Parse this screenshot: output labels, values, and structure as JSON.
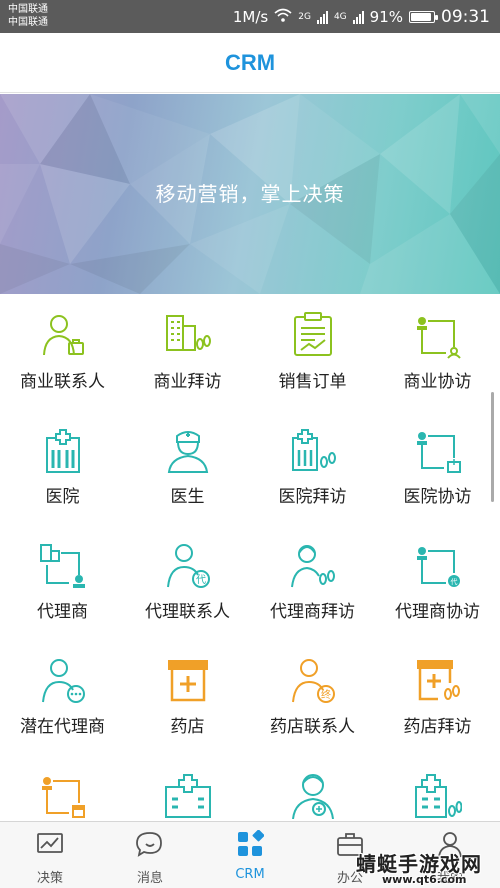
{
  "status_bar": {
    "carrier_1": "中国联通",
    "carrier_2": "中国联通",
    "speed": "1M/s",
    "net_label_1": "2G",
    "net_label_2": "4G",
    "battery_percent": "91%",
    "battery_level": 0.91,
    "time": "09:31",
    "icons": [
      "wifi-icon",
      "signal-icon",
      "battery-icon"
    ]
  },
  "header": {
    "title": "CRM"
  },
  "banner": {
    "slogan": "移动营销，掌上决策"
  },
  "colors": {
    "green": "#8cc21f",
    "teal": "#2ab6b0",
    "orange": "#f0a028",
    "blue": "#1e93dc"
  },
  "grid": {
    "items": [
      {
        "label": "商业联系人",
        "icon": "business-contact-icon"
      },
      {
        "label": "商业拜访",
        "icon": "business-visit-icon"
      },
      {
        "label": "销售订单",
        "icon": "sales-order-icon"
      },
      {
        "label": "商业协访",
        "icon": "business-co-visit-icon"
      },
      {
        "label": "医院",
        "icon": "hospital-icon"
      },
      {
        "label": "医生",
        "icon": "doctor-icon"
      },
      {
        "label": "医院拜访",
        "icon": "hospital-visit-icon"
      },
      {
        "label": "医院协访",
        "icon": "hospital-co-visit-icon"
      },
      {
        "label": "代理商",
        "icon": "agent-icon"
      },
      {
        "label": "代理联系人",
        "icon": "agent-contact-icon"
      },
      {
        "label": "代理商拜访",
        "icon": "agent-visit-icon"
      },
      {
        "label": "代理商协访",
        "icon": "agent-co-visit-icon"
      },
      {
        "label": "潜在代理商",
        "icon": "potential-agent-icon"
      },
      {
        "label": "药店",
        "icon": "pharmacy-icon"
      },
      {
        "label": "药店联系人",
        "icon": "pharmacy-contact-icon"
      },
      {
        "label": "药店拜访",
        "icon": "pharmacy-visit-icon"
      },
      {
        "label": "",
        "icon": "pharmacy-co-visit-icon"
      },
      {
        "label": "",
        "icon": "hospital-building-icon"
      },
      {
        "label": "",
        "icon": "doctor-plus-icon"
      },
      {
        "label": "",
        "icon": "hospital-visit-2-icon"
      }
    ]
  },
  "bottom_nav": {
    "items": [
      {
        "label": "决策",
        "icon": "chart-icon"
      },
      {
        "label": "消息",
        "icon": "message-icon"
      },
      {
        "label": "CRM",
        "icon": "crm-grid-icon",
        "active": true
      },
      {
        "label": "办公",
        "icon": "briefcase-icon"
      },
      {
        "label": "我的",
        "icon": "profile-icon"
      }
    ]
  },
  "watermark": {
    "title": "蜻蜓手游戏网",
    "url": "www.qt6.com"
  }
}
